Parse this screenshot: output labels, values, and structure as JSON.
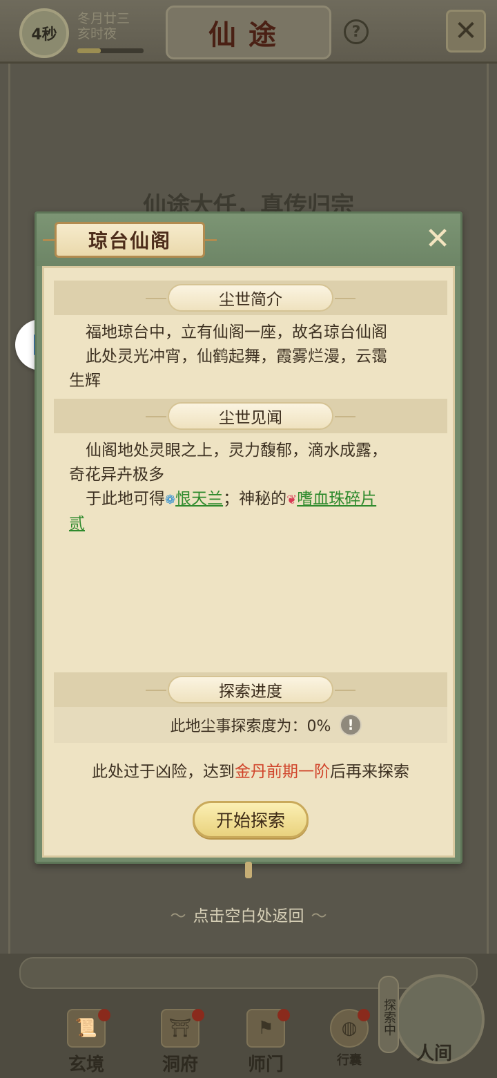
{
  "top_bar": {
    "timer": "4秒",
    "date_line1": "冬月廿三",
    "date_line2": "亥时夜",
    "title": "仙途",
    "help_glyph": "?",
    "close_glyph": "✕"
  },
  "background": {
    "heading": "仙途大任，真传归宗"
  },
  "modal": {
    "title": "琼台仙阁",
    "close_glyph": "✕",
    "sections": {
      "intro_title": "尘世简介",
      "intro_text": "福地琼台中，立有仙阁一座，故名琼台仙阁。此处灵光冲宵，仙鹤起舞，霞雾烂漫，云霭生辉",
      "intro_line1": "福地琼台中，立有仙阁一座，故名琼台仙阁",
      "intro_line2": "此处灵光冲宵，仙鹤起舞，霞雾烂漫，云霭",
      "intro_line3": "生辉",
      "lore_title": "尘世见闻",
      "lore_line1": "仙阁地处灵眼之上，灵力馥郁，滴水成露，",
      "lore_line2": "奇花异卉极多",
      "lore_prefix": "于此地可得",
      "lore_item1": "恨天兰",
      "lore_mid": "；神秘的",
      "lore_item2": "嗜血珠碎片",
      "lore_item2_tail": "贰",
      "progress_title": "探索进度",
      "progress_text": "此地尘事探索度为：0%",
      "progress_value": 0
    },
    "danger_prefix": "此处过于凶险，达到",
    "danger_realm": "金丹前期一阶",
    "danger_suffix": "后再来探索",
    "start_button": "开始探索"
  },
  "return_hint": "点击空白处返回",
  "bottom_nav": [
    {
      "label": "玄境",
      "icon": "scroll-icon"
    },
    {
      "label": "洞府",
      "icon": "pavilion-icon"
    },
    {
      "label": "师门",
      "icon": "banner-icon"
    },
    {
      "label": "行囊",
      "icon": "bag-icon"
    },
    {
      "label": "人间",
      "icon": "mountain-icon"
    }
  ],
  "explore_badge": "探索中",
  "colors": {
    "modal_green": "#738b6c",
    "paper": "#eee3c3",
    "link_green": "#2f8a2d",
    "realm_red": "#d0442a",
    "button_gold": "#e9d27e"
  }
}
